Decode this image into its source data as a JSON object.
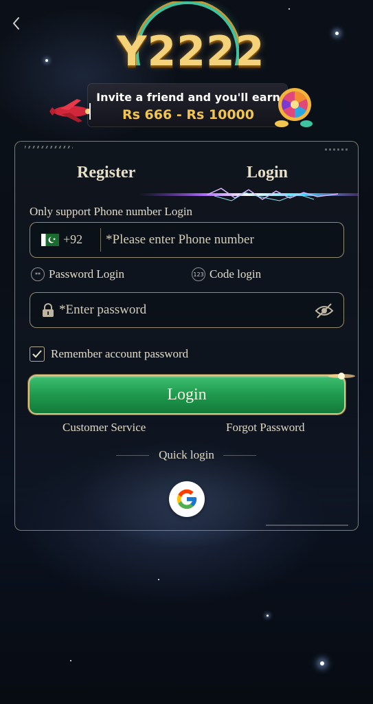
{
  "brand": {
    "logo_text": "Y2222"
  },
  "banner": {
    "line1": "Invite a friend and you'll earn",
    "line2": "Rs 666 - Rs 10000"
  },
  "tabs": [
    {
      "label": "Register",
      "active": false
    },
    {
      "label": "Login",
      "active": true
    }
  ],
  "form": {
    "support_text": "Only support Phone number Login",
    "country_code": "+92",
    "phone_placeholder": "*Please enter Phone number",
    "login_modes": [
      {
        "label": "Password Login",
        "badge": "**"
      },
      {
        "label": "Code login",
        "badge": "123"
      }
    ],
    "password_placeholder": "*Enter password",
    "remember_label": "Remember account password",
    "remember_checked": true,
    "login_button": "Login",
    "customer_service": "Customer Service",
    "forgot_password": "Forgot Password",
    "quick_login": "Quick login"
  },
  "colors": {
    "accent_green": "#1f9a4e",
    "gold": "#f2c64e",
    "border": "#d9c489"
  }
}
